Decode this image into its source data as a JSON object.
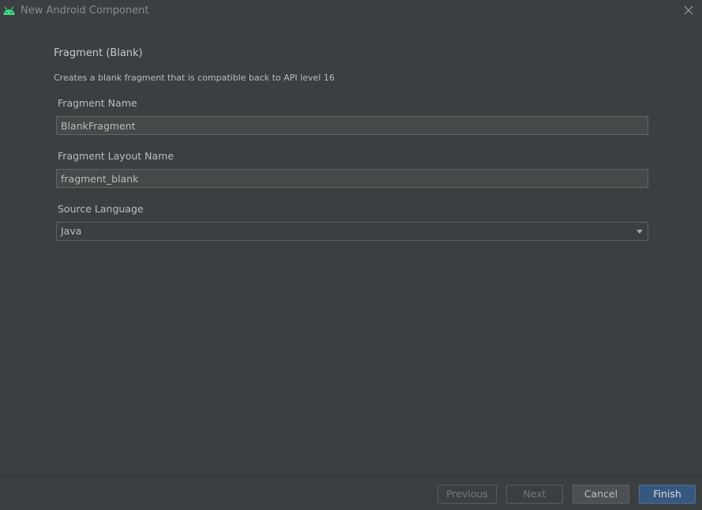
{
  "window": {
    "title": "New Android Component",
    "icons": {
      "app": "android-icon",
      "close": "close-icon"
    }
  },
  "content": {
    "heading": "Fragment (Blank)",
    "description": "Creates a blank fragment that is compatible back to API level 16",
    "fields": {
      "fragment_name": {
        "label": "Fragment Name",
        "value": "BlankFragment"
      },
      "layout_name": {
        "label": "Fragment Layout Name",
        "value": "fragment_blank"
      },
      "source_language": {
        "label": "Source Language",
        "value": "Java",
        "icon": "chevron-down-icon"
      }
    }
  },
  "footer": {
    "previous_label": "Previous",
    "next_label": "Next",
    "cancel_label": "Cancel",
    "finish_label": "Finish"
  },
  "colors": {
    "background": "#3c3f41",
    "android_green": "#3ddc84",
    "primary_button": "#365880"
  }
}
